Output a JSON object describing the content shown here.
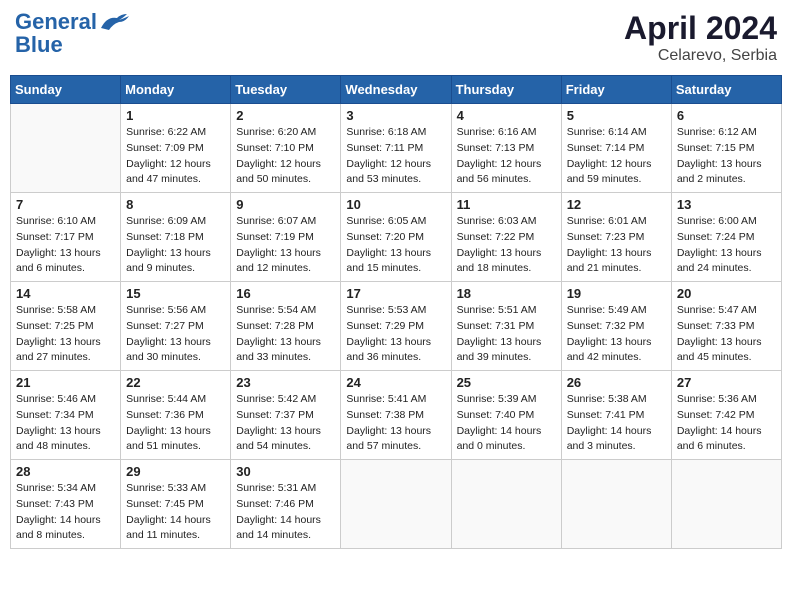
{
  "header": {
    "logo_line1": "General",
    "logo_line2": "Blue",
    "month_year": "April 2024",
    "location": "Celarevo, Serbia"
  },
  "weekdays": [
    "Sunday",
    "Monday",
    "Tuesday",
    "Wednesday",
    "Thursday",
    "Friday",
    "Saturday"
  ],
  "weeks": [
    [
      {
        "day": "",
        "empty": true
      },
      {
        "day": "1",
        "sunrise": "6:22 AM",
        "sunset": "7:09 PM",
        "daylight": "12 hours and 47 minutes."
      },
      {
        "day": "2",
        "sunrise": "6:20 AM",
        "sunset": "7:10 PM",
        "daylight": "12 hours and 50 minutes."
      },
      {
        "day": "3",
        "sunrise": "6:18 AM",
        "sunset": "7:11 PM",
        "daylight": "12 hours and 53 minutes."
      },
      {
        "day": "4",
        "sunrise": "6:16 AM",
        "sunset": "7:13 PM",
        "daylight": "12 hours and 56 minutes."
      },
      {
        "day": "5",
        "sunrise": "6:14 AM",
        "sunset": "7:14 PM",
        "daylight": "12 hours and 59 minutes."
      },
      {
        "day": "6",
        "sunrise": "6:12 AM",
        "sunset": "7:15 PM",
        "daylight": "13 hours and 2 minutes."
      }
    ],
    [
      {
        "day": "7",
        "sunrise": "6:10 AM",
        "sunset": "7:17 PM",
        "daylight": "13 hours and 6 minutes."
      },
      {
        "day": "8",
        "sunrise": "6:09 AM",
        "sunset": "7:18 PM",
        "daylight": "13 hours and 9 minutes."
      },
      {
        "day": "9",
        "sunrise": "6:07 AM",
        "sunset": "7:19 PM",
        "daylight": "13 hours and 12 minutes."
      },
      {
        "day": "10",
        "sunrise": "6:05 AM",
        "sunset": "7:20 PM",
        "daylight": "13 hours and 15 minutes."
      },
      {
        "day": "11",
        "sunrise": "6:03 AM",
        "sunset": "7:22 PM",
        "daylight": "13 hours and 18 minutes."
      },
      {
        "day": "12",
        "sunrise": "6:01 AM",
        "sunset": "7:23 PM",
        "daylight": "13 hours and 21 minutes."
      },
      {
        "day": "13",
        "sunrise": "6:00 AM",
        "sunset": "7:24 PM",
        "daylight": "13 hours and 24 minutes."
      }
    ],
    [
      {
        "day": "14",
        "sunrise": "5:58 AM",
        "sunset": "7:25 PM",
        "daylight": "13 hours and 27 minutes."
      },
      {
        "day": "15",
        "sunrise": "5:56 AM",
        "sunset": "7:27 PM",
        "daylight": "13 hours and 30 minutes."
      },
      {
        "day": "16",
        "sunrise": "5:54 AM",
        "sunset": "7:28 PM",
        "daylight": "13 hours and 33 minutes."
      },
      {
        "day": "17",
        "sunrise": "5:53 AM",
        "sunset": "7:29 PM",
        "daylight": "13 hours and 36 minutes."
      },
      {
        "day": "18",
        "sunrise": "5:51 AM",
        "sunset": "7:31 PM",
        "daylight": "13 hours and 39 minutes."
      },
      {
        "day": "19",
        "sunrise": "5:49 AM",
        "sunset": "7:32 PM",
        "daylight": "13 hours and 42 minutes."
      },
      {
        "day": "20",
        "sunrise": "5:47 AM",
        "sunset": "7:33 PM",
        "daylight": "13 hours and 45 minutes."
      }
    ],
    [
      {
        "day": "21",
        "sunrise": "5:46 AM",
        "sunset": "7:34 PM",
        "daylight": "13 hours and 48 minutes."
      },
      {
        "day": "22",
        "sunrise": "5:44 AM",
        "sunset": "7:36 PM",
        "daylight": "13 hours and 51 minutes."
      },
      {
        "day": "23",
        "sunrise": "5:42 AM",
        "sunset": "7:37 PM",
        "daylight": "13 hours and 54 minutes."
      },
      {
        "day": "24",
        "sunrise": "5:41 AM",
        "sunset": "7:38 PM",
        "daylight": "13 hours and 57 minutes."
      },
      {
        "day": "25",
        "sunrise": "5:39 AM",
        "sunset": "7:40 PM",
        "daylight": "14 hours and 0 minutes."
      },
      {
        "day": "26",
        "sunrise": "5:38 AM",
        "sunset": "7:41 PM",
        "daylight": "14 hours and 3 minutes."
      },
      {
        "day": "27",
        "sunrise": "5:36 AM",
        "sunset": "7:42 PM",
        "daylight": "14 hours and 6 minutes."
      }
    ],
    [
      {
        "day": "28",
        "sunrise": "5:34 AM",
        "sunset": "7:43 PM",
        "daylight": "14 hours and 8 minutes."
      },
      {
        "day": "29",
        "sunrise": "5:33 AM",
        "sunset": "7:45 PM",
        "daylight": "14 hours and 11 minutes."
      },
      {
        "day": "30",
        "sunrise": "5:31 AM",
        "sunset": "7:46 PM",
        "daylight": "14 hours and 14 minutes."
      },
      {
        "day": "",
        "empty": true
      },
      {
        "day": "",
        "empty": true
      },
      {
        "day": "",
        "empty": true
      },
      {
        "day": "",
        "empty": true
      }
    ]
  ],
  "labels": {
    "sunrise": "Sunrise:",
    "sunset": "Sunset:",
    "daylight": "Daylight hours"
  }
}
